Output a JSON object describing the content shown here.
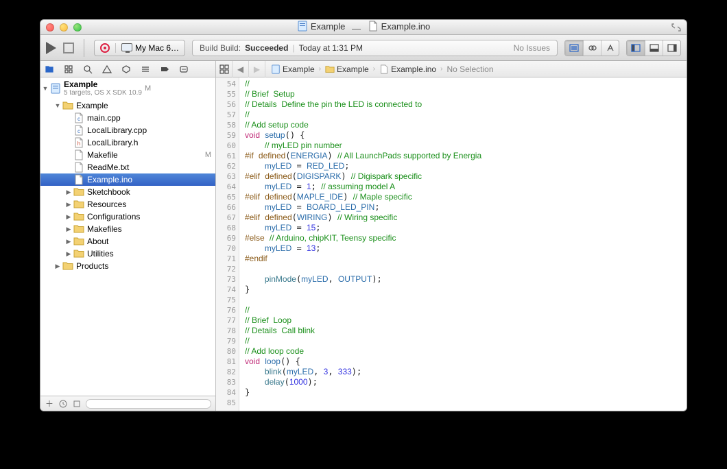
{
  "window": {
    "title_project": "Example",
    "title_sep": "—",
    "title_file": "Example.ino"
  },
  "toolbar": {
    "scheme_target": "My Mac 6…",
    "activity": {
      "prefix": "Build Build:",
      "status": "Succeeded",
      "time_sep": "|",
      "time": "Today at 1:31 PM",
      "issues": "No Issues"
    }
  },
  "navigator": {
    "project": {
      "name": "Example",
      "subtitle": "5 targets, OS X SDK 10.9",
      "badge": "M"
    },
    "tree": [
      {
        "kind": "folder",
        "open": true,
        "depth": 1,
        "label": "Example"
      },
      {
        "kind": "file",
        "depth": 2,
        "label": "main.cpp",
        "ftype": "cpp"
      },
      {
        "kind": "file",
        "depth": 2,
        "label": "LocalLibrary.cpp",
        "ftype": "cpp"
      },
      {
        "kind": "file",
        "depth": 2,
        "label": "LocalLibrary.h",
        "ftype": "h"
      },
      {
        "kind": "file",
        "depth": 2,
        "label": "Makefile",
        "ftype": "txt",
        "badge": "M"
      },
      {
        "kind": "file",
        "depth": 2,
        "label": "ReadMe.txt",
        "ftype": "txt"
      },
      {
        "kind": "file",
        "depth": 2,
        "label": "Example.ino",
        "ftype": "txt",
        "selected": true
      },
      {
        "kind": "folder",
        "open": false,
        "depth": 2,
        "label": "Sketchbook"
      },
      {
        "kind": "folder",
        "open": false,
        "depth": 2,
        "label": "Resources"
      },
      {
        "kind": "folder",
        "open": false,
        "depth": 2,
        "label": "Configurations"
      },
      {
        "kind": "folder",
        "open": false,
        "depth": 2,
        "label": "Makefiles"
      },
      {
        "kind": "folder",
        "open": false,
        "depth": 2,
        "label": "About"
      },
      {
        "kind": "folder",
        "open": false,
        "depth": 2,
        "label": "Utilities"
      },
      {
        "kind": "folder",
        "open": false,
        "depth": 1,
        "label": "Products"
      }
    ]
  },
  "jumpbar": {
    "crumbs": [
      "Example",
      "Example",
      "Example.ino",
      "No Selection"
    ]
  },
  "editor": {
    "first_line": 54,
    "lines": [
      [
        [
          "c",
          "//"
        ]
      ],
      [
        [
          "c",
          "// Brief  Setup"
        ]
      ],
      [
        [
          "c",
          "// Details  Define the pin the LED is connected to"
        ]
      ],
      [
        [
          "c",
          "//"
        ]
      ],
      [
        [
          "c",
          "// Add setup code"
        ]
      ],
      [
        [
          "k",
          "void"
        ],
        [
          "t",
          " "
        ],
        [
          "i",
          "setup"
        ],
        [
          "t",
          "() {"
        ]
      ],
      [
        [
          "t",
          "    "
        ],
        [
          "c",
          "// myLED pin number"
        ]
      ],
      [
        [
          "p",
          "#if"
        ],
        [
          "t",
          " "
        ],
        [
          "m",
          "defined"
        ],
        [
          "t",
          "("
        ],
        [
          "i",
          "ENERGIA"
        ],
        [
          "t",
          ") "
        ],
        [
          "c",
          "// All LaunchPads supported by Energia"
        ]
      ],
      [
        [
          "t",
          "    "
        ],
        [
          "i",
          "myLED"
        ],
        [
          "t",
          " = "
        ],
        [
          "i",
          "RED_LED"
        ],
        [
          "t",
          ";"
        ]
      ],
      [
        [
          "p",
          "#elif"
        ],
        [
          "t",
          " "
        ],
        [
          "m",
          "defined"
        ],
        [
          "t",
          "("
        ],
        [
          "i",
          "DIGISPARK"
        ],
        [
          "t",
          ") "
        ],
        [
          "c",
          "// Digispark specific"
        ]
      ],
      [
        [
          "t",
          "    "
        ],
        [
          "i",
          "myLED"
        ],
        [
          "t",
          " = "
        ],
        [
          "n",
          "1"
        ],
        [
          "t",
          "; "
        ],
        [
          "c",
          "// assuming model A"
        ]
      ],
      [
        [
          "p",
          "#elif"
        ],
        [
          "t",
          " "
        ],
        [
          "m",
          "defined"
        ],
        [
          "t",
          "("
        ],
        [
          "i",
          "MAPLE_IDE"
        ],
        [
          "t",
          ") "
        ],
        [
          "c",
          "// Maple specific"
        ]
      ],
      [
        [
          "t",
          "    "
        ],
        [
          "i",
          "myLED"
        ],
        [
          "t",
          " = "
        ],
        [
          "i",
          "BOARD_LED_PIN"
        ],
        [
          "t",
          ";"
        ]
      ],
      [
        [
          "p",
          "#elif"
        ],
        [
          "t",
          " "
        ],
        [
          "m",
          "defined"
        ],
        [
          "t",
          "("
        ],
        [
          "i",
          "WIRING"
        ],
        [
          "t",
          ") "
        ],
        [
          "c",
          "// Wiring specific"
        ]
      ],
      [
        [
          "t",
          "    "
        ],
        [
          "i",
          "myLED"
        ],
        [
          "t",
          " = "
        ],
        [
          "n",
          "15"
        ],
        [
          "t",
          ";"
        ]
      ],
      [
        [
          "p",
          "#else"
        ],
        [
          "t",
          " "
        ],
        [
          "c",
          "// Arduino, chipKIT, Teensy specific"
        ]
      ],
      [
        [
          "t",
          "    "
        ],
        [
          "i",
          "myLED"
        ],
        [
          "t",
          " = "
        ],
        [
          "n",
          "13"
        ],
        [
          "t",
          ";"
        ]
      ],
      [
        [
          "p",
          "#endif"
        ]
      ],
      [],
      [
        [
          "t",
          "    "
        ],
        [
          "f",
          "pinMode"
        ],
        [
          "t",
          "("
        ],
        [
          "i",
          "myLED"
        ],
        [
          "t",
          ", "
        ],
        [
          "i",
          "OUTPUT"
        ],
        [
          "t",
          ");"
        ]
      ],
      [
        [
          "t",
          "}"
        ]
      ],
      [],
      [
        [
          "c",
          "//"
        ]
      ],
      [
        [
          "c",
          "// Brief  Loop"
        ]
      ],
      [
        [
          "c",
          "// Details  Call blink"
        ]
      ],
      [
        [
          "c",
          "//"
        ]
      ],
      [
        [
          "c",
          "// Add loop code"
        ]
      ],
      [
        [
          "k",
          "void"
        ],
        [
          "t",
          " "
        ],
        [
          "i",
          "loop"
        ],
        [
          "t",
          "() {"
        ]
      ],
      [
        [
          "t",
          "    "
        ],
        [
          "f",
          "blink"
        ],
        [
          "t",
          "("
        ],
        [
          "i",
          "myLED"
        ],
        [
          "t",
          ", "
        ],
        [
          "n",
          "3"
        ],
        [
          "t",
          ", "
        ],
        [
          "n",
          "333"
        ],
        [
          "t",
          ");"
        ]
      ],
      [
        [
          "t",
          "    "
        ],
        [
          "f",
          "delay"
        ],
        [
          "t",
          "("
        ],
        [
          "n",
          "1000"
        ],
        [
          "t",
          ");"
        ]
      ],
      [
        [
          "t",
          "}"
        ]
      ],
      []
    ]
  }
}
